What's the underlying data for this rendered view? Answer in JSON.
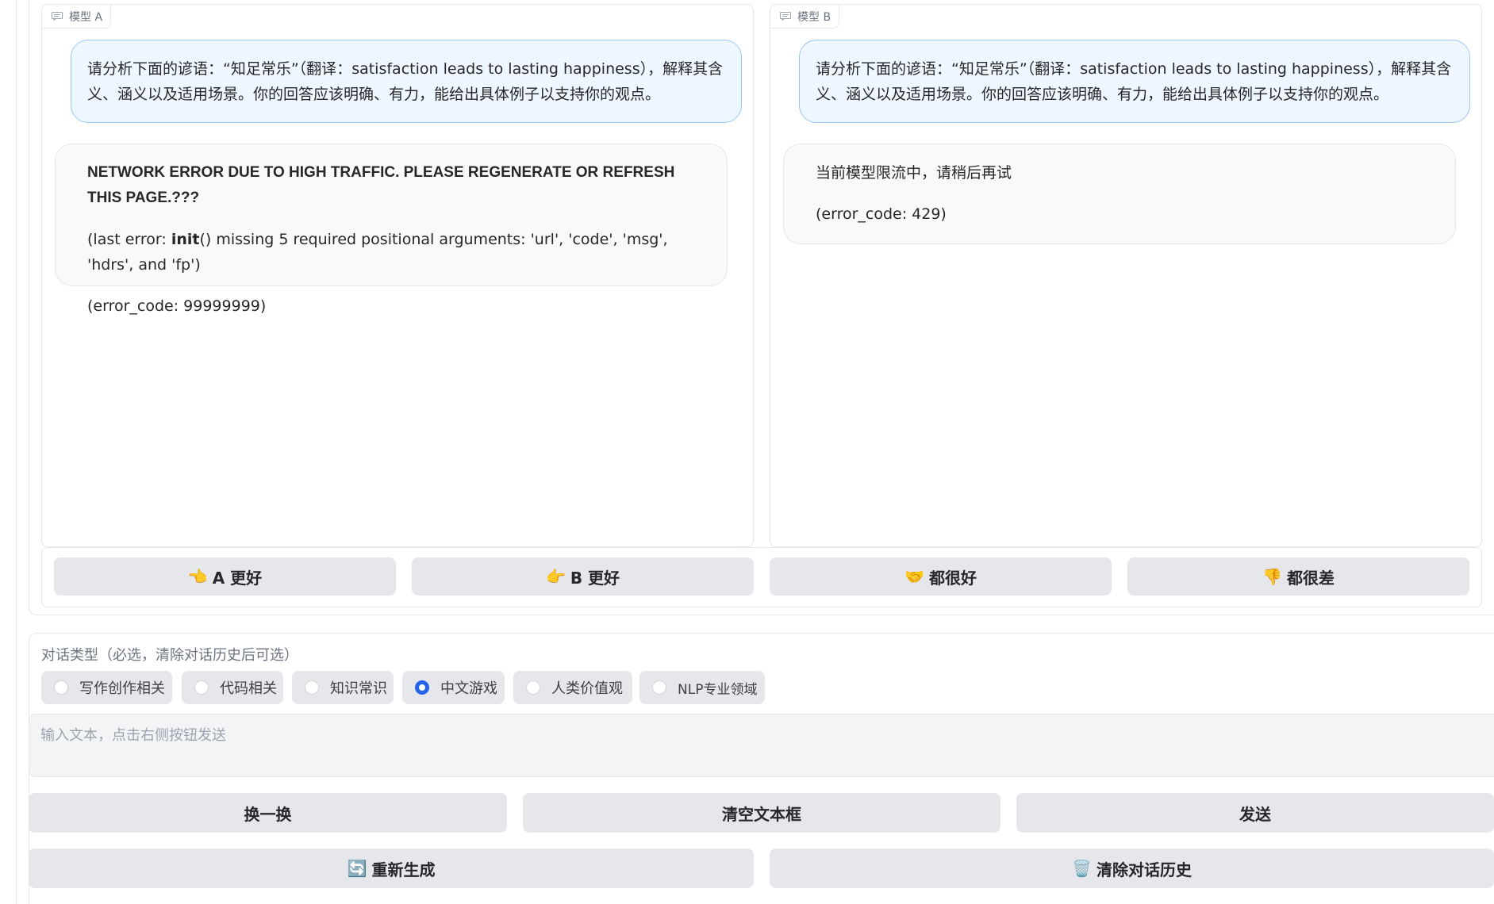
{
  "panel_a": {
    "label": "模型 A",
    "user_message": "请分析下面的谚语：“知足常乐”（翻译：satisfaction leads to lasting happiness），解释其含义、涵义以及适用场景。你的回答应该明确、有力，能给出具体例子以支持你的观点。",
    "bot_error_title": "NETWORK ERROR DUE TO HIGH TRAFFIC. PLEASE REGENERATE OR REFRESH THIS PAGE.???",
    "bot_error_detail_prefix": "(last error: ",
    "bot_error_detail_bold": "init",
    "bot_error_detail_suffix": "() missing 5 required positional arguments: 'url', 'code', 'msg', 'hdrs', and 'fp')",
    "bot_error_code": "(error_code: 99999999)"
  },
  "panel_b": {
    "label": "模型 B",
    "user_message": "请分析下面的谚语：“知足常乐”（翻译：satisfaction leads to lasting happiness），解释其含义、涵义以及适用场景。你的回答应该明确、有力，能给出具体例子以支持你的观点。",
    "bot_message": "当前模型限流中，请稍后再试",
    "bot_error_code": "(error_code: 429)"
  },
  "vote": {
    "a_better": {
      "emoji": "👈",
      "label": "A 更好"
    },
    "b_better": {
      "emoji": "👉",
      "label": "B 更好"
    },
    "both_good": {
      "emoji": "🤝",
      "label": "都很好"
    },
    "both_bad": {
      "emoji": "👎",
      "label": "都很差"
    }
  },
  "dialog_type": {
    "label": "对话类型（必选，清除对话历史后可选）",
    "options": [
      "写作创作相关",
      "代码相关",
      "知识常识",
      "中文游戏",
      "人类价值观",
      "NLP专业领域"
    ],
    "selected": "中文游戏"
  },
  "input": {
    "placeholder": "输入文本，点击右侧按钮发送",
    "value": ""
  },
  "actions": {
    "shuffle_label": "换一换",
    "clear_textbox_label": "清空文本框",
    "send_label": "发送",
    "regenerate_emoji": "🔄",
    "regenerate_label": "重新生成",
    "clear_history_emoji": "🗑️",
    "clear_history_label": "清除对话历史"
  },
  "colors": {
    "accent": "#2563eb",
    "user_bubble_bg": "#eef6ff",
    "user_bubble_border": "#9cc6f5",
    "button_bg": "#e5e7eb"
  }
}
